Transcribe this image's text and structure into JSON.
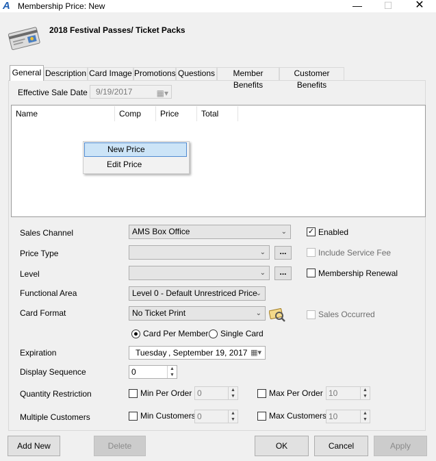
{
  "window": {
    "title": "Membership Price: New",
    "app_icon": "A",
    "min_glyph": "—",
    "max_glyph": "☐",
    "close_glyph": "✕"
  },
  "header": {
    "title": "2018 Festival Passes/ Ticket Packs",
    "icon": "membership-card-icon"
  },
  "tabs": [
    {
      "label": "General",
      "active": true
    },
    {
      "label": "Description"
    },
    {
      "label": "Card Image"
    },
    {
      "label": "Promotions"
    },
    {
      "label": "Questions"
    },
    {
      "label": "Member Benefits"
    },
    {
      "label": "Customer Benefits"
    }
  ],
  "effective_sale_date": {
    "label": "Effective Sale Date",
    "value": "9/19/2017"
  },
  "grid": {
    "columns": [
      "Name",
      "Comp",
      "Price",
      "Total"
    ]
  },
  "context_menu": {
    "items": [
      "New Price",
      "Edit Price"
    ],
    "highlighted": "New Price"
  },
  "form": {
    "sales_channel": {
      "label": "Sales Channel",
      "value": "AMS Box Office"
    },
    "enabled": {
      "label": "Enabled",
      "checked": true
    },
    "price_type": {
      "label": "Price Type",
      "value": ""
    },
    "include_service_fee": {
      "label": "Include Service Fee",
      "checked": false
    },
    "level": {
      "label": "Level",
      "value": ""
    },
    "membership_renewal": {
      "label": "Membership Renewal",
      "checked": false
    },
    "functional_area": {
      "label": "Functional Area",
      "value": "Level 0 - Default Unrestriced Price"
    },
    "card_format": {
      "label": "Card Format",
      "value": "No Ticket Print"
    },
    "sales_occurred": {
      "label": "Sales Occurred",
      "checked": false
    },
    "card_per_member": {
      "label": "Card Per Member",
      "selected": true
    },
    "single_card": {
      "label": "Single Card",
      "selected": false
    },
    "expiration": {
      "label": "Expiration",
      "day": "Tuesday",
      "date": ", September 19, 2017"
    },
    "display_sequence": {
      "label": "Display Sequence",
      "value": "0"
    },
    "quantity_restriction": {
      "label": "Quantity Restriction",
      "min_label": "Min Per Order",
      "min_value": "0",
      "max_label": "Max Per Order",
      "max_value": "10"
    },
    "multiple_customers": {
      "label": "Multiple Customers",
      "min_label": "Min Customers",
      "min_value": "0",
      "max_label": "Max Customers",
      "max_value": "10"
    },
    "ellipsis": "..."
  },
  "buttons": {
    "add_new": "Add New",
    "delete": "Delete",
    "ok": "OK",
    "cancel": "Cancel",
    "apply": "Apply"
  }
}
